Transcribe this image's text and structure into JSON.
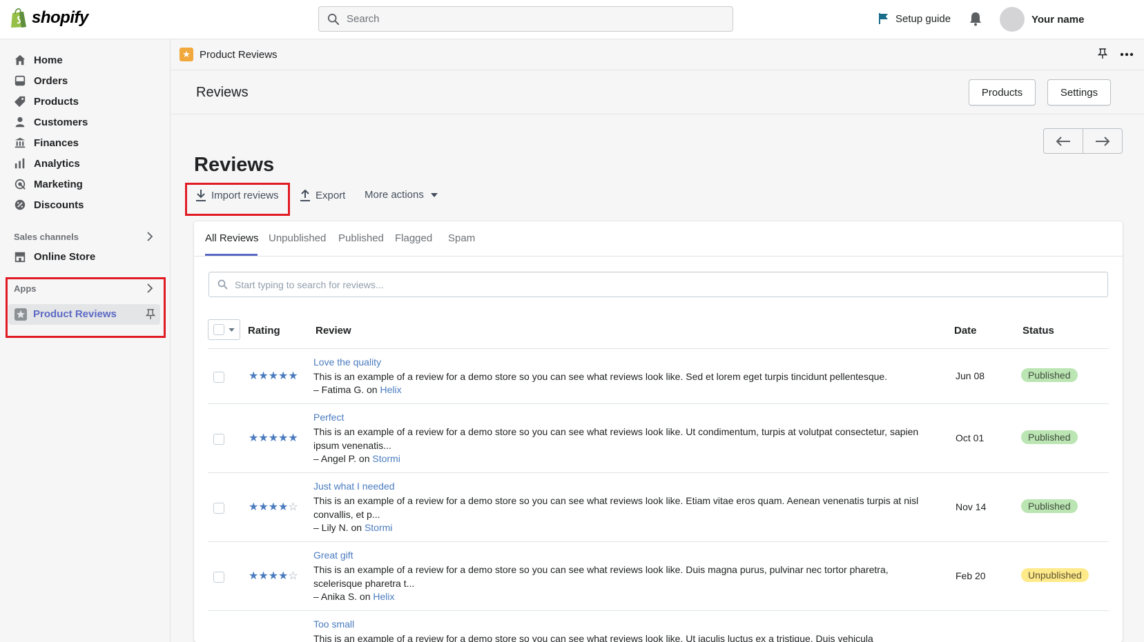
{
  "topbar": {
    "brand": "shopify",
    "search_placeholder": "Search",
    "setup_guide": "Setup guide",
    "user_name": "Your name"
  },
  "sidebar": {
    "items": [
      {
        "label": "Home",
        "icon": "home-icon"
      },
      {
        "label": "Orders",
        "icon": "orders-icon"
      },
      {
        "label": "Products",
        "icon": "tag-icon"
      },
      {
        "label": "Customers",
        "icon": "person-icon"
      },
      {
        "label": "Finances",
        "icon": "bank-icon"
      },
      {
        "label": "Analytics",
        "icon": "bar-chart-icon"
      },
      {
        "label": "Marketing",
        "icon": "target-icon"
      },
      {
        "label": "Discounts",
        "icon": "discount-icon"
      }
    ],
    "sales_channels_label": "Sales channels",
    "online_store": "Online Store",
    "apps_label": "Apps",
    "app_item": "Product Reviews"
  },
  "app_header": {
    "title": "Product Reviews"
  },
  "page_header": {
    "title": "Reviews",
    "products_button": "Products",
    "settings_button": "Settings"
  },
  "main": {
    "title": "Reviews",
    "actions": {
      "import": "Import reviews",
      "export": "Export",
      "more": "More actions"
    },
    "tabs": [
      "All Reviews",
      "Unpublished",
      "Published",
      "Flagged",
      "Spam"
    ],
    "filter_placeholder": "Start typing to search for reviews...",
    "columns": {
      "rating": "Rating",
      "review": "Review",
      "date": "Date",
      "status": "Status"
    },
    "reviews": [
      {
        "rating": 5,
        "title": "Love the quality",
        "body": "This is an example of a review for a demo store so you can see what reviews look like. Sed et lorem eget turpis tincidunt pellentesque.",
        "author": "– Fatima G. on ",
        "product": "Helix",
        "date": "Jun 08",
        "status": "Published"
      },
      {
        "rating": 5,
        "title": "Perfect",
        "body": "This is an example of a review for a demo store so you can see what reviews look like. Ut condimentum, turpis at volutpat consectetur, sapien ipsum venenatis...",
        "author": "– Angel P. on ",
        "product": "Stormi",
        "date": "Oct 01",
        "status": "Published"
      },
      {
        "rating": 4,
        "title": "Just what I needed",
        "body": "This is an example of a review for a demo store so you can see what reviews look like. Etiam vitae eros quam. Aenean venenatis turpis at nisl convallis, et p...",
        "author": "– Lily N. on ",
        "product": "Stormi",
        "date": "Nov 14",
        "status": "Published"
      },
      {
        "rating": 4,
        "title": "Great gift",
        "body": "This is an example of a review for a demo store so you can see what reviews look like. Duis magna purus, pulvinar nec tortor pharetra, scelerisque pharetra t...",
        "author": "– Anika S. on ",
        "product": "Helix",
        "date": "Feb 20",
        "status": "Unpublished"
      },
      {
        "rating": 0,
        "title": "Too small",
        "body": "This is an example of a review for a demo store so you can see what reviews look like. Ut iaculis luctus ex a tristique. Duis vehicula",
        "author": "",
        "product": "",
        "date": "",
        "status": ""
      }
    ]
  },
  "colors": {
    "accent": "#5c6ac4",
    "link": "#4a7bbf",
    "highlight": "#e01b24",
    "published_badge": "#bbe5b3",
    "unpublished_badge": "#ffea8a"
  }
}
